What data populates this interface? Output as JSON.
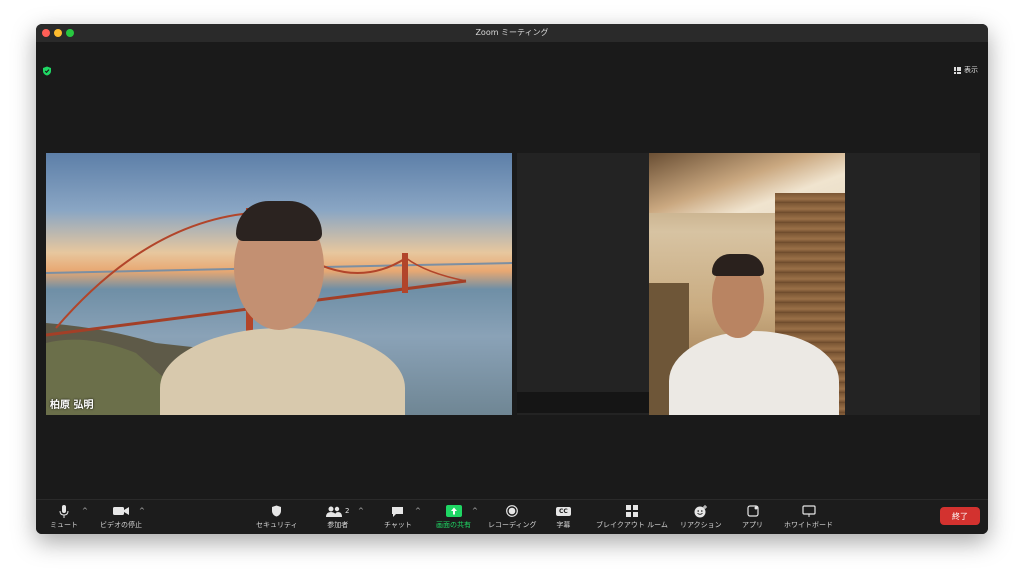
{
  "window": {
    "title": "Zoom ミーティング"
  },
  "header": {
    "view_label": "表示"
  },
  "participants": [
    {
      "name": "柏原 弘明"
    },
    {
      "name": ""
    }
  ],
  "toolbar": {
    "mute_label": "ミュート",
    "video_label": "ビデオの停止",
    "security_label": "セキュリティ",
    "participants_label": "参加者",
    "participants_count": "2",
    "chat_label": "チャット",
    "share_label": "画面の共有",
    "record_label": "レコーディング",
    "captions_label": "字幕",
    "captions_icon_text": "CC",
    "breakout_label": "ブレイクアウト ルーム",
    "reactions_label": "リアクション",
    "apps_label": "アプリ",
    "whiteboard_label": "ホワイトボード",
    "end_label": "終了"
  },
  "colors": {
    "accent": "#1fd764",
    "end": "#d3322f",
    "background": "#1a1a1a"
  }
}
